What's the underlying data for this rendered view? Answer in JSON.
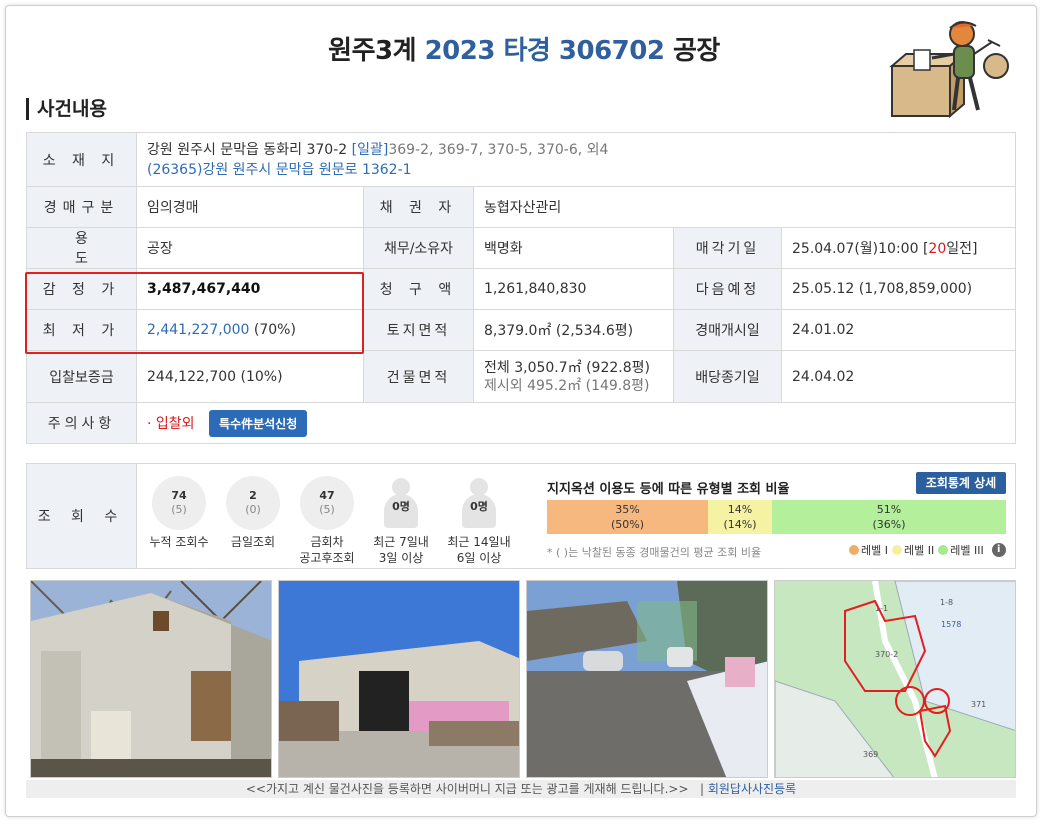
{
  "header": {
    "court": "원주3계",
    "case_number": "2023 타경 306702",
    "category": "공장"
  },
  "section_title": "사건내용",
  "info": {
    "location_label": "소 재 지",
    "address_line1": "강원 원주시 문막읍 동화리 370-2",
    "bundle_tag": "[일괄]",
    "address_extra": "369-2, 369-7, 370-5, 370-6, 외4",
    "road_address": "(26365)강원 원주시 문막읍 원문로 1362-1",
    "auction_type_label": "경매구분",
    "auction_type_value": "임의경매",
    "creditor_label": "채 권 자",
    "creditor_value": "농협자산관리",
    "use_label": "용 도",
    "use_value": "공장",
    "debtor_label": "채무/소유자",
    "debtor_value": "백명화",
    "sale_date_label": "매각기일",
    "sale_date_value": "25.04.07(월)10:00 [",
    "sale_date_days": "20",
    "sale_date_suffix": "일전]",
    "appraisal_label": "감 정 가",
    "appraisal_value": "3,487,467,440",
    "claim_label": "청 구 액",
    "claim_value": "1,261,840,830",
    "next_label": "다음예정",
    "next_value": "25.05.12 (1,708,859,000)",
    "min_price_label": "최 저 가",
    "min_price_value": "2,441,227,000",
    "min_price_pct": " (70%)",
    "land_area_label": "토지면적",
    "land_area_value": "8,379.0㎡ (2,534.6평)",
    "start_label": "경매개시일",
    "start_value": "24.01.02",
    "deposit_label": "입찰보증금",
    "deposit_value": "244,122,700 (10%)",
    "building_area_label": "건물면적",
    "building_area_total": "전체 3,050.7㎡ (922.8평)",
    "building_area_excluded": "제시외 495.2㎡ (149.8평)",
    "dividend_label": "배당종기일",
    "dividend_value": "24.04.02",
    "caution_label": "주의사항",
    "caution_value": "· 입찰외",
    "analysis_button": "특수件분석신청"
  },
  "views": {
    "label": "조 회 수",
    "items": [
      {
        "num": "74",
        "sub": "(5)",
        "label1": "누적 조회수",
        "label2": ""
      },
      {
        "num": "2",
        "sub": "(0)",
        "label1": "금일조회",
        "label2": ""
      },
      {
        "num": "47",
        "sub": "(5)",
        "label1": "금회차",
        "label2": "공고후조회"
      },
      {
        "num": "0명",
        "sub": "",
        "label1": "최근 7일내",
        "label2": "3일 이상"
      },
      {
        "num": "0명",
        "sub": "",
        "label1": "최근 14일내",
        "label2": "6일 이상"
      }
    ],
    "stats_title": "지지옥션 이용도 등에 따른 유형별 조회 비율",
    "stats_button": "조회통계 상세",
    "bars": [
      {
        "pct": "35%",
        "sub": "(50%)",
        "value": 35,
        "color": "#f6b87e"
      },
      {
        "pct": "14%",
        "sub": "(14%)",
        "value": 14,
        "color": "#f5f2a3"
      },
      {
        "pct": "51%",
        "sub": "(36%)",
        "value": 51,
        "color": "#b4ef9b"
      }
    ],
    "note": "* ( )는 낙찰된 동종 경매물건의 평균 조회 비율",
    "legend": [
      "레벨 I",
      "레벨 II",
      "레벨 III"
    ],
    "legend_colors": [
      "#f0ad68",
      "#f5f0a0",
      "#a7e98d"
    ]
  },
  "ad_bar": {
    "text": "<<가지고 계신 물건사진을 등록하면 사이버머니 지급 또는 광고를 게재해 드립니다.>>",
    "link": "회원답사사진등록"
  },
  "map_labels": [
    "1-1",
    "1-8",
    "1578",
    "370-2",
    "371",
    "369"
  ]
}
